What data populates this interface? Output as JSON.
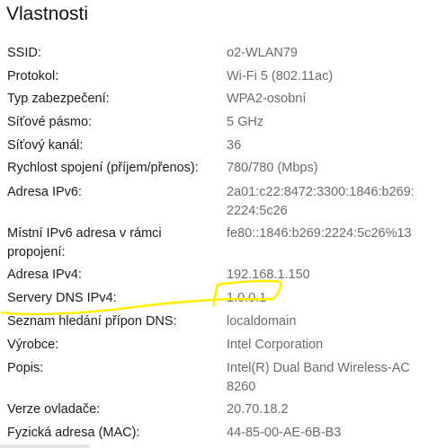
{
  "page": {
    "title": "Vlastnosti"
  },
  "properties": [
    {
      "label": "SSID:",
      "value": "o2-WLAN79"
    },
    {
      "label": "Protokol:",
      "value": "Wi-Fi 5 (802.11ac)"
    },
    {
      "label": "Typ zabezpečení:",
      "value": "WPA2-osobní"
    },
    {
      "label": "Síťové pásmo:",
      "value": "5 GHz"
    },
    {
      "label": "Síťový kanál:",
      "value": "36"
    },
    {
      "label": "Rychlost spojení (příjem/přenos):",
      "value": "780/780 (Mbps)"
    },
    {
      "label": "Adresa IPv6:",
      "value": "2a01:c22:8472:3300:1846:b269:\n2224:5c26"
    },
    {
      "label": "Místní IPv6 adresa v rámci propojení:",
      "value": "fe80::1846:b269:2224:5c26%13"
    },
    {
      "label": "Adresa IPv4:",
      "value": "192.168.1.150"
    },
    {
      "label": "Servery DNS IPv4:",
      "value": "1.0.0.1"
    },
    {
      "label": "Seznam hledání přípon DNS:",
      "value": "localdomain"
    },
    {
      "label": "Výrobce:",
      "value": "Intel Corporation"
    },
    {
      "label": "Popis:",
      "value": "Intel(R) Dual Band Wireless-AC 8260"
    },
    {
      "label": "Verze ovladače:",
      "value": "20.70.18.2"
    },
    {
      "label": "Fyzická adresa (MAC):",
      "value": "44-85-00-AE-6B-B3"
    }
  ],
  "annotation": {
    "color": "#ffee00"
  }
}
